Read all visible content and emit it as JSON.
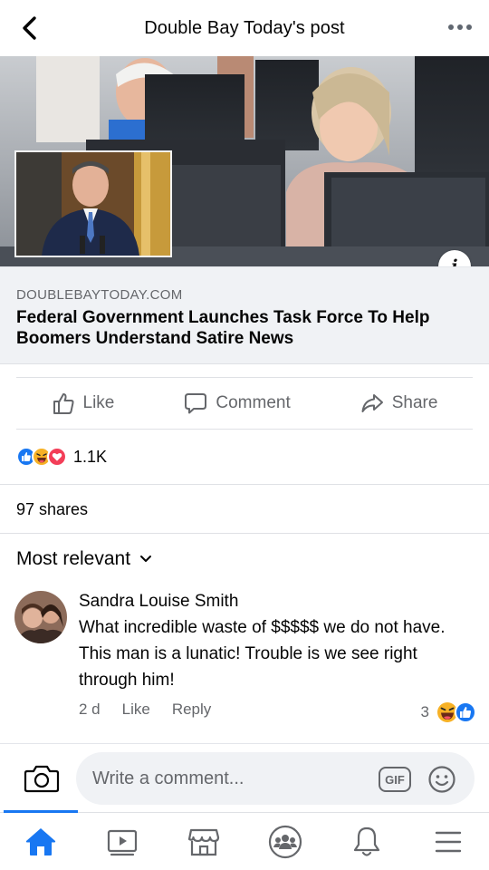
{
  "header": {
    "title": "Double Bay Today's post",
    "back_icon": "chevron-left-icon",
    "more_icon": "more-horizontal-icon"
  },
  "link_preview": {
    "domain": "DOUBLEBAYTODAY.COM",
    "title": "Federal Government Launches Task Force To Help Boomers Understand Satire News",
    "info_badge": "i"
  },
  "actions": {
    "like_label": "Like",
    "comment_label": "Comment",
    "share_label": "Share"
  },
  "reactions": {
    "count": "1.1K",
    "icons": [
      "like-reaction-icon",
      "haha-reaction-icon",
      "love-reaction-icon"
    ]
  },
  "shares_text": "97 shares",
  "sort_label": "Most relevant",
  "comment": {
    "author": "Sandra Louise Smith",
    "text": "What incredible waste of $$$$$ we do not have. This man is a lunatic! Trouble is we see right through him!",
    "time": "2 d",
    "like_label": "Like",
    "reply_label": "Reply",
    "reaction_count": "3"
  },
  "composer": {
    "placeholder": "Write a comment...",
    "gif_label": "GIF"
  },
  "bottom_nav": [
    "home-icon",
    "watch-icon",
    "marketplace-icon",
    "groups-icon",
    "notifications-icon",
    "menu-icon"
  ],
  "colors": {
    "accent": "#1877f2",
    "secondary_text": "#65676b",
    "link_box_bg": "#f0f2f5",
    "haha": "#f7b125",
    "love": "#f33e58"
  }
}
